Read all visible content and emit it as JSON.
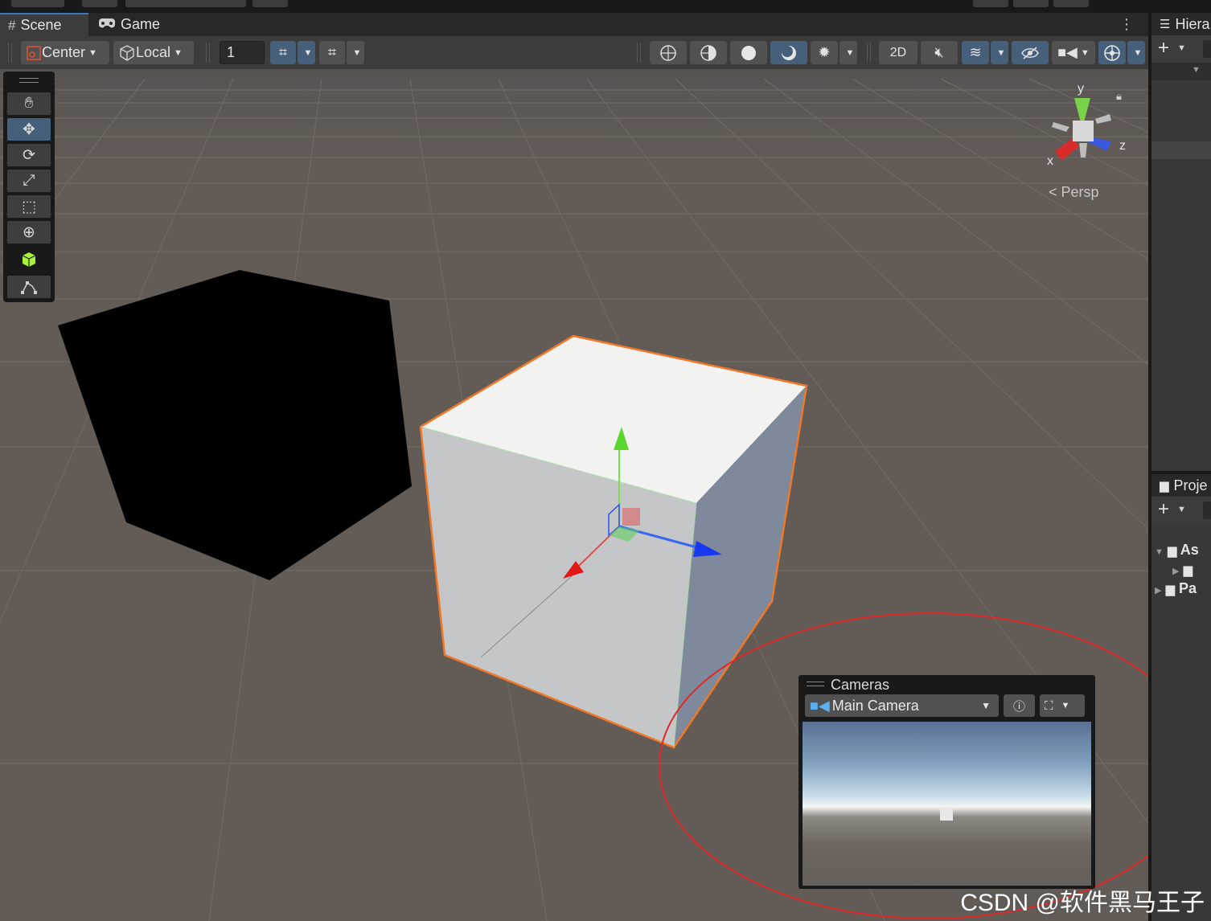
{
  "tabs": [
    {
      "label": "Scene",
      "icon": "grid-icon"
    },
    {
      "label": "Game",
      "icon": "gamepad-icon"
    }
  ],
  "toolbar": {
    "pivot_label": "Center",
    "space_label": "Local",
    "grid_value": "1",
    "mode_2d_label": "2D"
  },
  "gizmo": {
    "y_label": "y",
    "x_label": "x",
    "z_label": "z",
    "projection_label": "Persp"
  },
  "tools": [
    "hand-tool",
    "move-tool",
    "rotate-tool",
    "scale-tool",
    "rect-tool",
    "transform-tool",
    "custom-tool",
    "path-tool"
  ],
  "right_panel": {
    "hierarchy_title": "Hiera",
    "project_title": "Proje",
    "tree": [
      {
        "label": "As"
      },
      {
        "label": ""
      },
      {
        "label": "Pa"
      }
    ]
  },
  "cameras_overlay": {
    "title": "Cameras",
    "selected_camera": "Main Camera"
  },
  "watermark": "CSDN @软件黑马王子",
  "colors": {
    "accent": "#3a79bb",
    "selection_outline": "#f07828",
    "highlight_circle": "#e02828"
  }
}
